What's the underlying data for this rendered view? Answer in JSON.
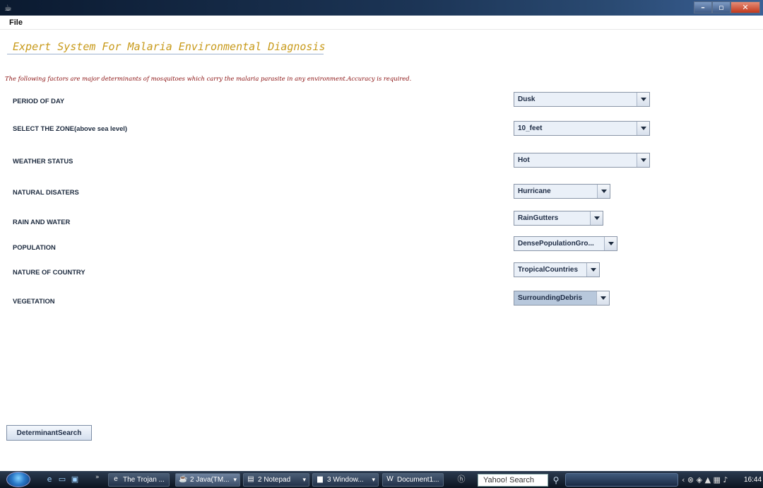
{
  "menu": {
    "file": "File"
  },
  "app": {
    "title": "Expert System For Malaria Environmental Diagnosis",
    "intro": "The following factors are major determinants of mosquitoes which carry the malaria parasite in any environment.Accuracy is required."
  },
  "fields": [
    {
      "label": "PERIOD OF DAY",
      "value": "Dusk"
    },
    {
      "label": "SELECT THE ZONE(above sea level)",
      "value": "10_feet"
    },
    {
      "label": "WEATHER STATUS",
      "value": "Hot"
    },
    {
      "label": "NATURAL DISATERS",
      "value": "Hurricane"
    },
    {
      "label": "RAIN AND WATER",
      "value": "RainGutters"
    },
    {
      "label": "POPULATION",
      "value": "DensePopulationGro..."
    },
    {
      "label": "NATURE OF COUNTRY",
      "value": "TropicalCountries"
    },
    {
      "label": "VEGETATION",
      "value": "SurroundingDebris"
    }
  ],
  "actions": {
    "search": "DeterminantSearch"
  },
  "taskbar": {
    "tasks": [
      {
        "label": "The Trojan ...",
        "icon": "ie-icon"
      },
      {
        "label": "2 Java(TM...",
        "icon": "java-icon"
      },
      {
        "label": "2 Notepad",
        "icon": "notepad-icon"
      },
      {
        "label": "3 Window...",
        "icon": "folder-icon"
      },
      {
        "label": "Document1...",
        "icon": "word-icon"
      }
    ],
    "search": "Yahoo! Search",
    "clock": "16:44"
  },
  "colors": {
    "title": "#c89a1a",
    "intro": "#8a1010",
    "label": "#1c2a3e"
  }
}
